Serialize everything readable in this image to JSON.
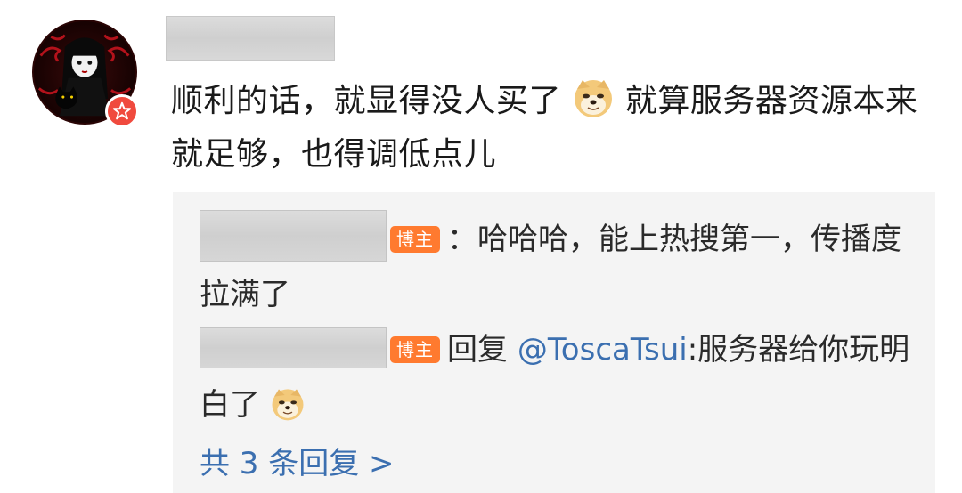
{
  "comment": {
    "text_part1": "顺利的话，就显得没人买了",
    "text_part2": "就算服务器资源本来就足够，也得调低点儿",
    "emoji_icon": "doge-emoji"
  },
  "replies": [
    {
      "tag": "博主",
      "text": "：哈哈哈，能上热搜第一，传播度拉满了"
    },
    {
      "tag": "博主",
      "prefix": "回复 ",
      "mention": "@ToscaTsui",
      "text": ":服务器给你玩明白了",
      "emoji_icon": "doge-emoji"
    }
  ],
  "more_replies": "共 3 条回复 >",
  "colors": {
    "link": "#3b6fb0",
    "tag": "#ff7a2f",
    "badge": "#f04a3e",
    "panel": "#f4f4f4"
  }
}
